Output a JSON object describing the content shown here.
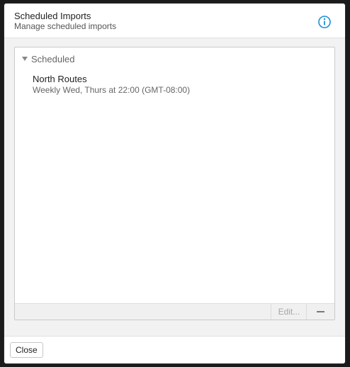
{
  "dialog": {
    "title": "Scheduled Imports",
    "subtitle": "Manage scheduled imports",
    "info_icon": "info-circle-icon",
    "accent_color": "#1a8fd6"
  },
  "list": {
    "group_label": "Scheduled",
    "group_icon": "disclosure-triangle-down-icon",
    "items": [
      {
        "name": "North Routes",
        "schedule": "Weekly Wed, Thurs at 22:00 (GMT-08:00)"
      }
    ],
    "edit_label": "Edit...",
    "remove_icon": "minus-icon"
  },
  "footer": {
    "close_label": "Close"
  }
}
